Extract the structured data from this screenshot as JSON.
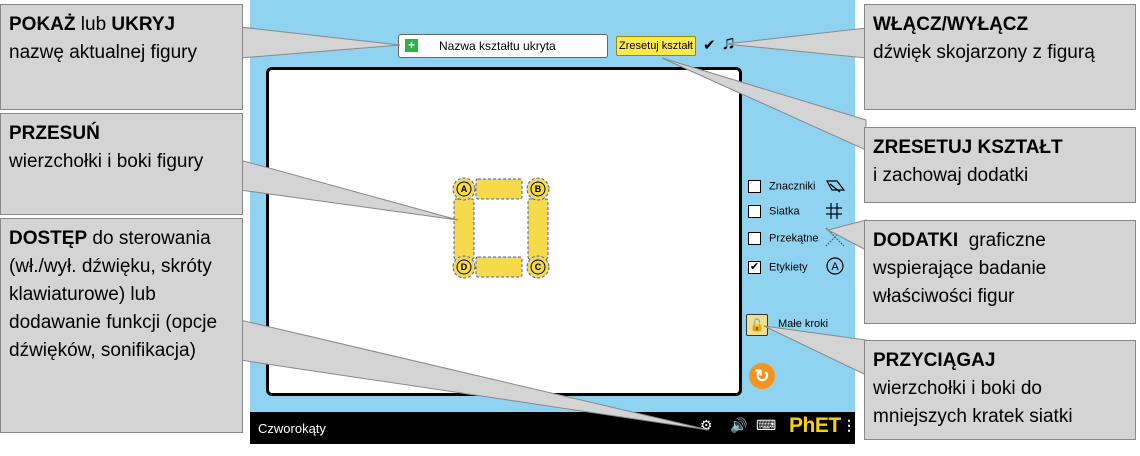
{
  "sim": {
    "title": "Czworokąty",
    "name_button_label": "Nazwa kształtu ukryta",
    "reset_shape_label": "Zresetuj kształt",
    "sound_checked": "✔",
    "note_icon": "♫",
    "vertex_labels": [
      "A",
      "B",
      "C",
      "D"
    ],
    "tools": [
      {
        "label": "Znaczniki",
        "checked": "",
        "icon": "markers-icon"
      },
      {
        "label": "Siatka",
        "checked": "",
        "icon": "grid-icon"
      },
      {
        "label": "Przekątne",
        "checked": "",
        "icon": "diagonals-icon"
      },
      {
        "label": "Etykiety",
        "checked": "✔",
        "icon": "labels-icon"
      }
    ],
    "small_steps_label": "Małe kroki",
    "logo": "PhET",
    "colors": {
      "background": "#8fd3f0",
      "accent_yellow": "#ffe94a",
      "side_yellow": "#f7d94c",
      "reset_orange": "#f4941e"
    }
  },
  "callouts": {
    "show_hide": {
      "bold1": "POKAŻ",
      "mid": " lub ",
      "bold2": "UKRYJ",
      "rest": "nazwę aktualnej figury"
    },
    "move": {
      "bold": "PRZESUŃ",
      "rest": "wierzchołki i boki figury"
    },
    "access": {
      "bold": "DOSTĘP",
      "rest": " do sterowania (wł./wył. dźwięku, skróty klawiaturowe) lub dodawanie funkcji (opcje dźwięków, sonifikacja)"
    },
    "sound": {
      "bold": "WŁĄCZ/WYŁĄCZ",
      "rest": "dźwięk skojarzony z figurą"
    },
    "reset": {
      "bold": "ZRESETUJ KSZTAŁT",
      "rest": "i zachowaj dodatki"
    },
    "extras": {
      "bold": "DODATKI",
      "rest": "graficzne wspierające badanie właściwości figur"
    },
    "snap": {
      "bold": "PRZYCIĄGAJ",
      "rest": "wierzchołki i boki do mniejszych kratek siatki"
    }
  }
}
